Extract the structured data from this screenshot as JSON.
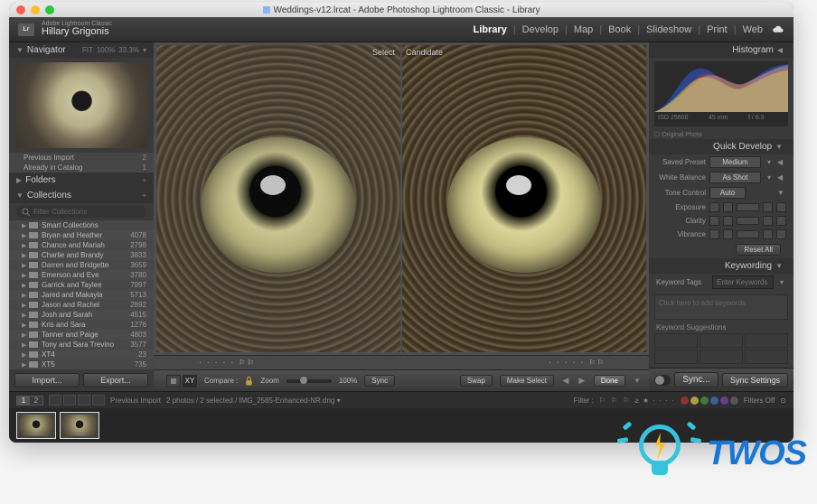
{
  "titlebar": {
    "title": "Weddings-v12.lrcat - Adobe Photoshop Lightroom Classic - Library"
  },
  "identity": {
    "brand": "Adobe Lightroom Classic",
    "name": "Hillary Grigonis"
  },
  "modules": {
    "items": [
      "Library",
      "Develop",
      "Map",
      "Book",
      "Slideshow",
      "Print",
      "Web"
    ],
    "active": "Library"
  },
  "navigator": {
    "title": "Navigator",
    "mode1": "FIT",
    "mode2": "100%",
    "zoom": "33.3%"
  },
  "catalog": {
    "rows": [
      {
        "label": "Previous Import",
        "count": "2"
      },
      {
        "label": "Already in Catalog",
        "count": "1"
      }
    ]
  },
  "folders": {
    "title": "Folders"
  },
  "collections": {
    "title": "Collections",
    "filter_placeholder": "Filter Collections",
    "items": [
      {
        "label": "Smart Collections",
        "count": ""
      },
      {
        "label": "Bryan and Heather",
        "count": "4078"
      },
      {
        "label": "Chance and Mariah",
        "count": "2798"
      },
      {
        "label": "Charlie and Brandy",
        "count": "3833"
      },
      {
        "label": "Darren and Bridgette",
        "count": "3659"
      },
      {
        "label": "Emerson and Eve",
        "count": "3780"
      },
      {
        "label": "Garrick and Taylee",
        "count": "7997"
      },
      {
        "label": "Jared and Makayla",
        "count": "5713"
      },
      {
        "label": "Jason and Rachel",
        "count": "2892"
      },
      {
        "label": "Josh and Sarah",
        "count": "4515"
      },
      {
        "label": "Kris and Sara",
        "count": "1276"
      },
      {
        "label": "Tanner and Paige",
        "count": "4803"
      },
      {
        "label": "Tony and Sara Trevino",
        "count": "3577"
      },
      {
        "label": "XT4",
        "count": "23"
      },
      {
        "label": "XT5",
        "count": "735"
      }
    ]
  },
  "left_buttons": {
    "import": "Import...",
    "export": "Export..."
  },
  "compare": {
    "select_label": "Select",
    "candidate_label": "Candidate"
  },
  "toolbar": {
    "compare": "Compare :",
    "zoom": "Zoom",
    "zoom_value": "100%",
    "sync": "Sync",
    "swap": "Swap",
    "make_select": "Make Select",
    "done": "Done"
  },
  "secondary": {
    "window1": "1",
    "window2": "2",
    "source": "Previous Import",
    "counts": "2 photos / 2 selected / IMG_2585-Enhanced-NR.dng ▾",
    "filter_label": "Filter :",
    "filters_off": "Filters Off"
  },
  "histogram": {
    "title": "Histogram",
    "iso": "ISO 25600",
    "focal": "45 mm",
    "aperture": "f / 6.3",
    "shutter": "",
    "original": "☐ Original Photo"
  },
  "quick_develop": {
    "title": "Quick Develop",
    "preset_label": "Saved Preset",
    "preset_value": "Medium",
    "wb_label": "White Balance",
    "wb_value": "As Shot",
    "tone_label": "Tone Control",
    "tone_value": "Auto",
    "exposure": "Exposure",
    "clarity": "Clarity",
    "vibrance": "Vibrance",
    "reset": "Reset All"
  },
  "keywording": {
    "title": "Keywording",
    "tags_label": "Keyword Tags",
    "tags_value": "Enter Keywords",
    "placeholder": "Click here to add keywords",
    "suggestions_label": "Keyword Suggestions"
  },
  "sync_bar": {
    "sync": "Sync...",
    "sync_settings": "Sync Settings"
  },
  "twos": {
    "text": "TWOS"
  }
}
